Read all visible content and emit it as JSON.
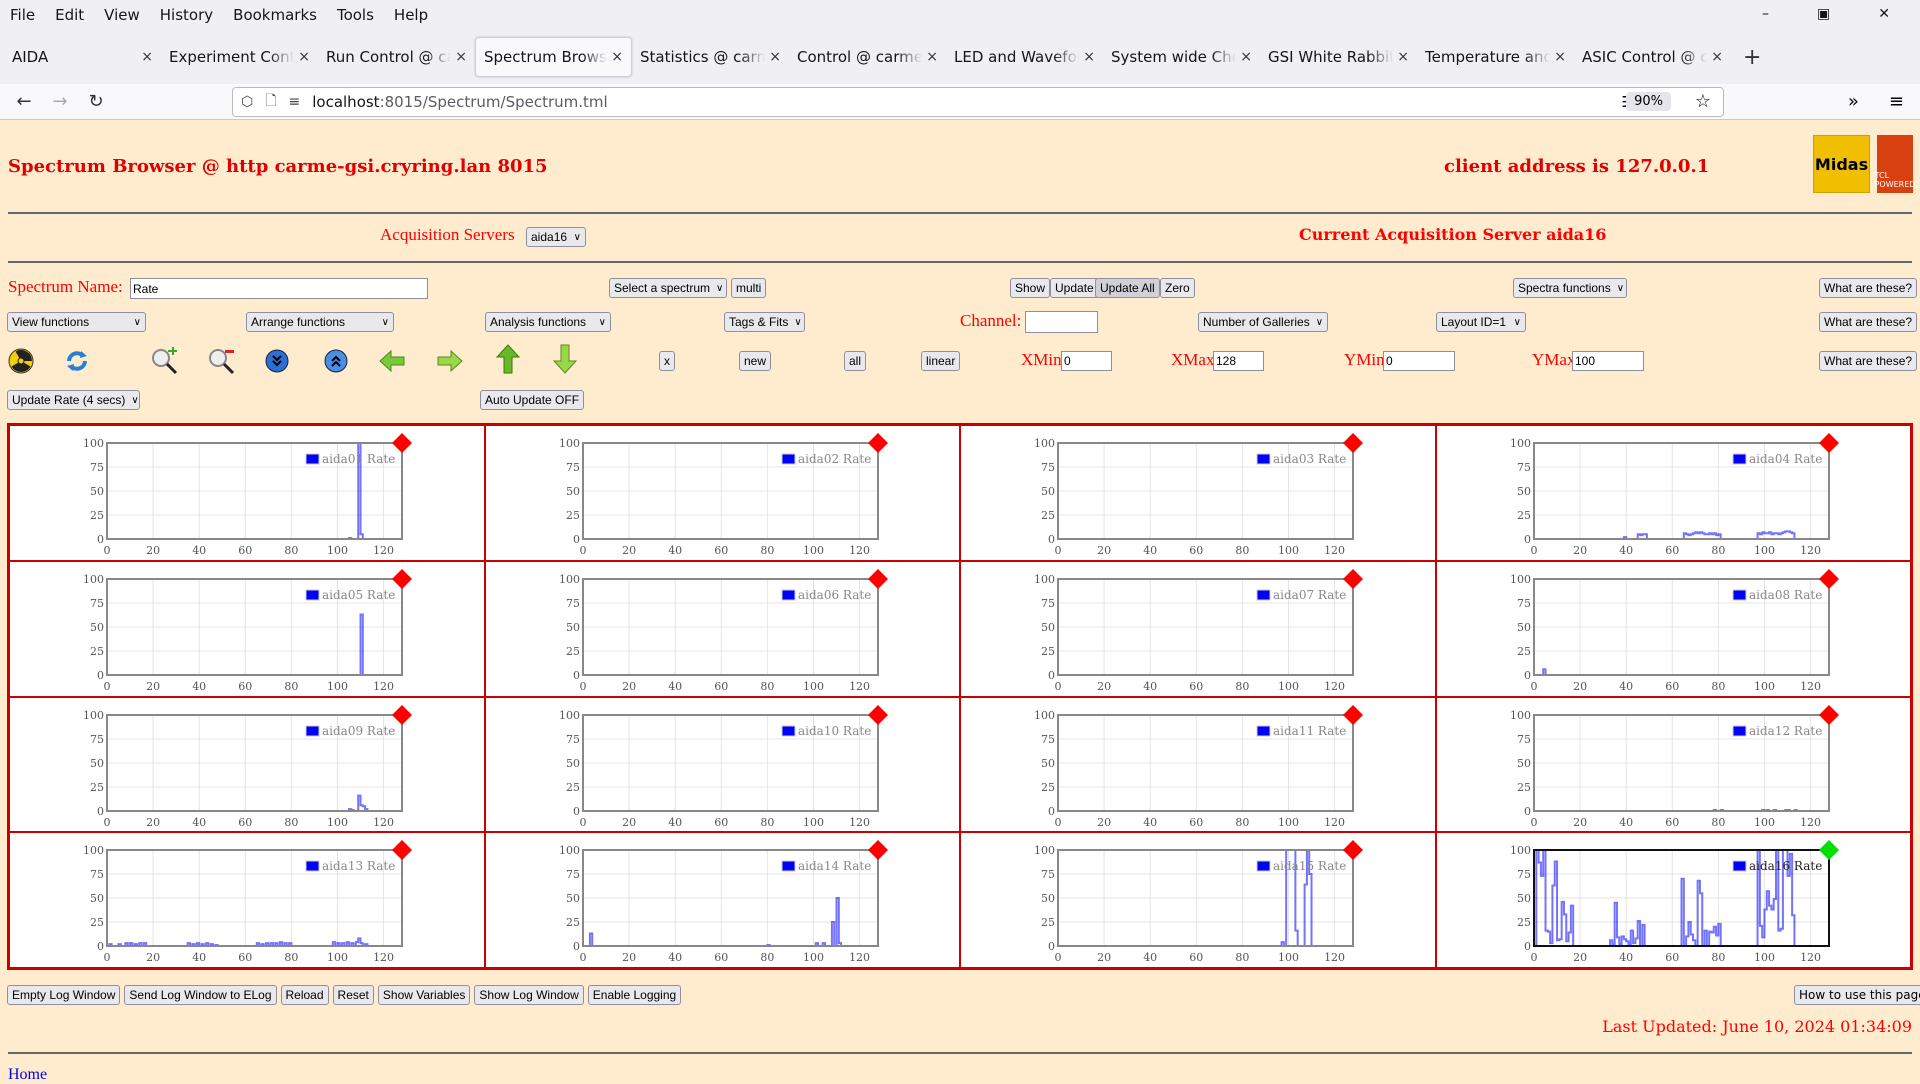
{
  "browser": {
    "menu": [
      "File",
      "Edit",
      "View",
      "History",
      "Bookmarks",
      "Tools",
      "Help"
    ],
    "tabs": [
      {
        "label": "AIDA",
        "active": false
      },
      {
        "label": "Experiment Control",
        "active": false
      },
      {
        "label": "Run Control @ carme",
        "active": false
      },
      {
        "label": "Spectrum Browser",
        "active": true
      },
      {
        "label": "Statistics @ carme",
        "active": false
      },
      {
        "label": "Control @ carme-gsi",
        "active": false
      },
      {
        "label": "LED and Waveform",
        "active": false
      },
      {
        "label": "System wide Check",
        "active": false
      },
      {
        "label": "GSI White Rabbit T",
        "active": false
      },
      {
        "label": "Temperature and st",
        "active": false
      },
      {
        "label": "ASIC Control @ carme",
        "active": false
      }
    ],
    "url_host": "localhost",
    "url_path": ":8015/Spectrum/Spectrum.tml",
    "zoom": "90%"
  },
  "header": {
    "title": "Spectrum Browser @ http carme-gsi.cryring.lan 8015",
    "client": "client address is 127.0.0.1",
    "logo_midas": "Midas",
    "logo_tcl": "TCL POWERED"
  },
  "acq": {
    "label": "Acquisition Servers",
    "selected": "aida16",
    "current": "Current Acquisition Server aida16"
  },
  "controls": {
    "spectrum_name_label": "Spectrum Name:",
    "spectrum_name_value": "Rate",
    "select_spectrum": "Select a spectrum",
    "multi": "multi",
    "show": "Show",
    "update": "Update",
    "update_all": "Update All",
    "zero": "Zero",
    "spectra_functions": "Spectra functions",
    "what1": "What are these?",
    "view_functions": "View functions",
    "arrange_functions": "Arrange functions",
    "analysis_functions": "Analysis functions",
    "tags_fits": "Tags & Fits",
    "channel_label": "Channel:",
    "channel_value": "",
    "galleries": "Number of Galleries",
    "layout": "Layout ID=1",
    "what2": "What are these?",
    "x": "x",
    "new": "new",
    "all": "all",
    "linear": "linear",
    "xmin_label": "XMin",
    "xmin": "0",
    "xmax_label": "XMax",
    "xmax": "128",
    "ymin_label": "YMin",
    "ymin": "0",
    "ymax_label": "YMax",
    "ymax": "100",
    "what3": "What are these?",
    "update_rate": "Update Rate (4 secs)",
    "auto_update": "Auto Update OFF"
  },
  "footer": {
    "buttons": [
      "Empty Log Window",
      "Send Log Window to ELog",
      "Reload",
      "Reset",
      "Show Variables",
      "Show Log Window",
      "Enable Logging"
    ],
    "howto": "How to use this page",
    "last_updated": "Last Updated: June 10, 2024 01:34:09",
    "home": "Home"
  },
  "chart_data": {
    "type": "line",
    "xlim": [
      0,
      128
    ],
    "ylim": [
      0,
      100
    ],
    "xticks": [
      0,
      20,
      40,
      60,
      80,
      100,
      120
    ],
    "yticks": [
      0,
      25,
      50,
      75,
      100
    ],
    "colors": {
      "line": "#0000ff",
      "marker_red": "#ff0000",
      "marker_green": "#00e000"
    },
    "panels": [
      {
        "name": "aida01 Rate",
        "status": "red",
        "spikes": [
          [
            105,
            1
          ],
          [
            109,
            100
          ],
          [
            110,
            5
          ]
        ]
      },
      {
        "name": "aida02 Rate",
        "status": "red",
        "spikes": []
      },
      {
        "name": "aida03 Rate",
        "status": "red",
        "spikes": []
      },
      {
        "name": "aida04 Rate",
        "status": "red",
        "spikes": [
          [
            39,
            2
          ],
          [
            45,
            5
          ],
          [
            46,
            4
          ],
          [
            47,
            5
          ],
          [
            48,
            5
          ],
          [
            65,
            6
          ],
          [
            66,
            5
          ],
          [
            67,
            4
          ],
          [
            68,
            5
          ],
          [
            69,
            6
          ],
          [
            70,
            7
          ],
          [
            71,
            6
          ],
          [
            72,
            7
          ],
          [
            73,
            6
          ],
          [
            74,
            5
          ],
          [
            75,
            5
          ],
          [
            76,
            6
          ],
          [
            77,
            5
          ],
          [
            78,
            6
          ],
          [
            79,
            4
          ],
          [
            80,
            5
          ],
          [
            97,
            6
          ],
          [
            98,
            5
          ],
          [
            99,
            7
          ],
          [
            100,
            6
          ],
          [
            101,
            6
          ],
          [
            102,
            7
          ],
          [
            103,
            5
          ],
          [
            104,
            6
          ],
          [
            105,
            6
          ],
          [
            106,
            5
          ],
          [
            107,
            6
          ],
          [
            108,
            7
          ],
          [
            109,
            8
          ],
          [
            110,
            8
          ],
          [
            111,
            7
          ],
          [
            112,
            6
          ]
        ]
      },
      {
        "name": "aida05 Rate",
        "status": "red",
        "spikes": [
          [
            110,
            63
          ]
        ]
      },
      {
        "name": "aida06 Rate",
        "status": "red",
        "spikes": []
      },
      {
        "name": "aida07 Rate",
        "status": "red",
        "spikes": []
      },
      {
        "name": "aida08 Rate",
        "status": "red",
        "spikes": [
          [
            4,
            6
          ]
        ]
      },
      {
        "name": "aida09 Rate",
        "status": "red",
        "spikes": [
          [
            105,
            2
          ],
          [
            106,
            1
          ],
          [
            109,
            16
          ],
          [
            110,
            6
          ],
          [
            111,
            5
          ],
          [
            112,
            2
          ]
        ]
      },
      {
        "name": "aida10 Rate",
        "status": "red",
        "spikes": []
      },
      {
        "name": "aida11 Rate",
        "status": "red",
        "spikes": []
      },
      {
        "name": "aida12 Rate",
        "status": "red",
        "spikes": [
          [
            78,
            1
          ],
          [
            81,
            1
          ],
          [
            99,
            1
          ],
          [
            101,
            1
          ],
          [
            104,
            1
          ],
          [
            109,
            1
          ],
          [
            110,
            1
          ],
          [
            113,
            1
          ]
        ]
      },
      {
        "name": "aida13 Rate",
        "status": "red",
        "spikes": [
          [
            1,
            2
          ],
          [
            5,
            2
          ],
          [
            8,
            3
          ],
          [
            10,
            3
          ],
          [
            12,
            2
          ],
          [
            14,
            3
          ],
          [
            16,
            3
          ],
          [
            35,
            3
          ],
          [
            37,
            2
          ],
          [
            39,
            3
          ],
          [
            41,
            2
          ],
          [
            43,
            3
          ],
          [
            45,
            2
          ],
          [
            47,
            1
          ],
          [
            65,
            3
          ],
          [
            67,
            2
          ],
          [
            69,
            3
          ],
          [
            71,
            3
          ],
          [
            73,
            3
          ],
          [
            75,
            4
          ],
          [
            77,
            3
          ],
          [
            79,
            3
          ],
          [
            98,
            4
          ],
          [
            100,
            3
          ],
          [
            102,
            3
          ],
          [
            104,
            4
          ],
          [
            106,
            3
          ],
          [
            108,
            4
          ],
          [
            109,
            8
          ],
          [
            110,
            3
          ],
          [
            112,
            2
          ]
        ]
      },
      {
        "name": "aida14 Rate",
        "status": "red",
        "spikes": [
          [
            3,
            13
          ],
          [
            80,
            1
          ],
          [
            101,
            3
          ],
          [
            104,
            3
          ],
          [
            108,
            25
          ],
          [
            110,
            50
          ],
          [
            111,
            3
          ]
        ]
      },
      {
        "name": "aida15 Rate",
        "status": "red",
        "spikes": [
          [
            97,
            4
          ],
          [
            99,
            100
          ],
          [
            100,
            100
          ],
          [
            101,
            100
          ],
          [
            102,
            100
          ],
          [
            103,
            16
          ],
          [
            107,
            64
          ],
          [
            108,
            100
          ],
          [
            109,
            75
          ]
        ]
      },
      {
        "name": "aida16 Rate",
        "status": "green",
        "spikes": [
          [
            1,
            100
          ],
          [
            2,
            87
          ],
          [
            3,
            73
          ],
          [
            4,
            100
          ],
          [
            5,
            16
          ],
          [
            6,
            15
          ],
          [
            7,
            3
          ],
          [
            8,
            63
          ],
          [
            9,
            88
          ],
          [
            10,
            6
          ],
          [
            11,
            7
          ],
          [
            12,
            46
          ],
          [
            13,
            33
          ],
          [
            14,
            5
          ],
          [
            15,
            14
          ],
          [
            16,
            42
          ],
          [
            33,
            6
          ],
          [
            34,
            2
          ],
          [
            35,
            45
          ],
          [
            36,
            9
          ],
          [
            37,
            2
          ],
          [
            38,
            10
          ],
          [
            39,
            7
          ],
          [
            40,
            5
          ],
          [
            41,
            2
          ],
          [
            42,
            16
          ],
          [
            43,
            3
          ],
          [
            44,
            8
          ],
          [
            45,
            26
          ],
          [
            47,
            22
          ],
          [
            64,
            70
          ],
          [
            66,
            10
          ],
          [
            67,
            25
          ],
          [
            68,
            12
          ],
          [
            69,
            6
          ],
          [
            71,
            68
          ],
          [
            72,
            55
          ],
          [
            74,
            16
          ],
          [
            76,
            15
          ],
          [
            77,
            14
          ],
          [
            78,
            20
          ],
          [
            79,
            11
          ],
          [
            80,
            23
          ],
          [
            97,
            100
          ],
          [
            98,
            21
          ],
          [
            99,
            9
          ],
          [
            100,
            38
          ],
          [
            101,
            57
          ],
          [
            102,
            42
          ],
          [
            103,
            38
          ],
          [
            104,
            49
          ],
          [
            105,
            100
          ],
          [
            106,
            16
          ],
          [
            107,
            18
          ],
          [
            108,
            100
          ],
          [
            109,
            100
          ],
          [
            110,
            73
          ],
          [
            111,
            96
          ],
          [
            112,
            32
          ]
        ]
      }
    ]
  }
}
